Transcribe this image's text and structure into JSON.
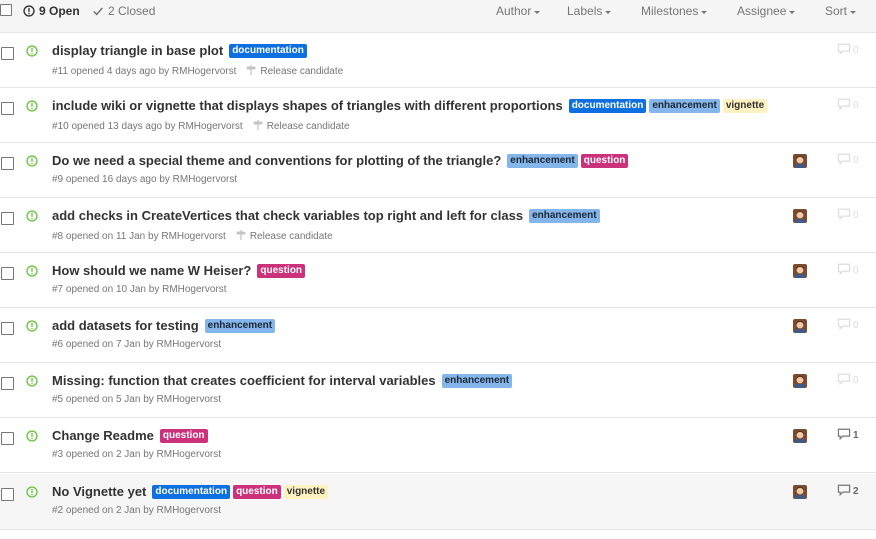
{
  "header": {
    "open_label": "9 Open",
    "closed_label": "2 Closed",
    "filters": [
      "Author",
      "Labels",
      "Milestones",
      "Assignee",
      "Sort"
    ]
  },
  "colors": {
    "documentation": "#0e6fe0",
    "enhancement": "#84b6eb",
    "vignette": "#fef2c0",
    "question": "#cc317c",
    "open_icon": "#6cc644"
  },
  "issues": [
    {
      "title": "display triangle in base plot",
      "labels": [
        "documentation"
      ],
      "meta": "#11 opened 4 days ago by RMHogervorst",
      "milestone": "Release candidate",
      "has_avatar": false,
      "comments": "0"
    },
    {
      "title": "include wiki or vignette that displays shapes of triangles with different proportions",
      "labels": [
        "documentation",
        "enhancement",
        "vignette"
      ],
      "meta": "#10 opened 13 days ago by RMHogervorst",
      "milestone": "Release candidate",
      "has_avatar": false,
      "comments": "0"
    },
    {
      "title": "Do we need a special theme and conventions for plotting of the triangle?",
      "labels": [
        "enhancement",
        "question"
      ],
      "meta": "#9 opened 16 days ago by RMHogervorst",
      "milestone": "",
      "has_avatar": true,
      "comments": "0"
    },
    {
      "title": "add checks in CreateVertices that check variables top right and left for class",
      "labels": [
        "enhancement"
      ],
      "meta": "#8 opened on 11 Jan by RMHogervorst",
      "milestone": "Release candidate",
      "has_avatar": true,
      "comments": "0"
    },
    {
      "title": "How should we name W Heiser?",
      "labels": [
        "question"
      ],
      "meta": "#7 opened on 10 Jan by RMHogervorst",
      "milestone": "",
      "has_avatar": true,
      "comments": "0"
    },
    {
      "title": "add datasets for testing",
      "labels": [
        "enhancement"
      ],
      "meta": "#6 opened on 7 Jan by RMHogervorst",
      "milestone": "",
      "has_avatar": true,
      "comments": "0"
    },
    {
      "title": "Missing: function that creates coefficient for interval variables",
      "labels": [
        "enhancement"
      ],
      "meta": "#5 opened on 5 Jan by RMHogervorst",
      "milestone": "",
      "has_avatar": true,
      "comments": "0"
    },
    {
      "title": "Change Readme",
      "labels": [
        "question"
      ],
      "meta": "#3 opened on 2 Jan by RMHogervorst",
      "milestone": "",
      "has_avatar": true,
      "comments": "1"
    },
    {
      "title": "No Vignette yet",
      "labels": [
        "documentation",
        "question",
        "vignette"
      ],
      "meta": "#2 opened on 2 Jan by RMHogervorst",
      "milestone": "",
      "has_avatar": true,
      "comments": "2"
    }
  ]
}
